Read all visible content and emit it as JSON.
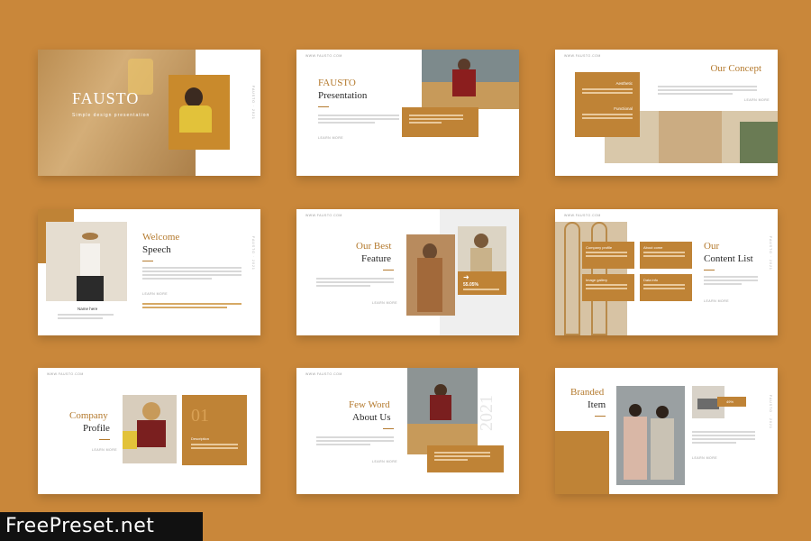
{
  "slides": {
    "s1": {
      "title": "FAUSTO",
      "subtitle": "Simple design presentation"
    },
    "s2": {
      "title1": "FAUSTO",
      "title2": "Presentation",
      "learn": "LEARN MORE"
    },
    "s3": {
      "title": "Our Concept",
      "box_h1": "Aesthetic",
      "box_h2": "Functional",
      "learn": "LEARN MORE"
    },
    "s4": {
      "title1": "Welcome",
      "title2": "Speech",
      "caption": "Name here",
      "learn": "LEARN MORE"
    },
    "s5": {
      "title1": "Our Best",
      "title2": "Feature",
      "stat": "55.05%",
      "learn": "LEARN MORE"
    },
    "s6": {
      "title1": "Our",
      "title2": "Content List",
      "items": [
        "Company profile",
        "About come",
        "Image gallery",
        "Data info"
      ],
      "learn": "LEARN MORE"
    },
    "s7": {
      "title1": "Company",
      "title2": "Profile",
      "number": "01",
      "box_h": "Description",
      "learn": "LEARN MORE"
    },
    "s8": {
      "title1": "Few Word",
      "title2": "About Us",
      "year": "2021",
      "learn": "LEARN MORE"
    },
    "s9": {
      "title1": "Branded",
      "title2": "Item",
      "badge": "49%",
      "learn": "LEARN MORE"
    }
  },
  "url_text": "WWW.FAUSTO.COM",
  "watermark": "FreePreset.net",
  "colors": {
    "background": "#c9873a",
    "accent": "#bf8336",
    "slide": "#ffffff"
  }
}
